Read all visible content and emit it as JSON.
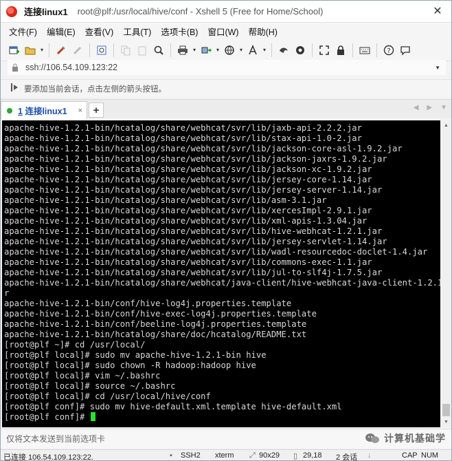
{
  "titlebar": {
    "app_name": "连接linux1",
    "title": "root@plf:/usr/local/hive/conf - Xshell 5 (Free for Home/School)",
    "close_label": "✕"
  },
  "menubar": {
    "items": [
      "文件(F)",
      "编辑(E)",
      "查看(V)",
      "工具(T)",
      "选项卡(B)",
      "窗口(W)",
      "帮助(H)"
    ]
  },
  "toolbar": {
    "icons": [
      "new-session-icon",
      "open-folder-icon",
      "reconnect-icon",
      "disconnect-icon",
      "properties-icon",
      "copy-icon",
      "paste-icon",
      "find-icon",
      "print-icon",
      "transfer-icon",
      "globe-icon",
      "font-icon",
      "xftp-icon",
      "xmanager-icon",
      "fullscreen-icon",
      "lock-icon",
      "keyboard-icon",
      "help-icon",
      "chat-icon"
    ]
  },
  "address": {
    "url": "ssh://106.54.109.123:22"
  },
  "hint": {
    "text": "要添加当前会话，点击左侧的箭头按钮。"
  },
  "tabs": {
    "active": {
      "number": "1",
      "label": "连接linux1",
      "close": "×"
    },
    "add": "+"
  },
  "terminal": {
    "lines": [
      "apache-hive-1.2.1-bin/hcatalog/share/webhcat/svr/lib/jaxb-api-2.2.2.jar",
      "apache-hive-1.2.1-bin/hcatalog/share/webhcat/svr/lib/stax-api-1.0-2.jar",
      "apache-hive-1.2.1-bin/hcatalog/share/webhcat/svr/lib/jackson-core-asl-1.9.2.jar",
      "apache-hive-1.2.1-bin/hcatalog/share/webhcat/svr/lib/jackson-jaxrs-1.9.2.jar",
      "apache-hive-1.2.1-bin/hcatalog/share/webhcat/svr/lib/jackson-xc-1.9.2.jar",
      "apache-hive-1.2.1-bin/hcatalog/share/webhcat/svr/lib/jersey-core-1.14.jar",
      "apache-hive-1.2.1-bin/hcatalog/share/webhcat/svr/lib/jersey-server-1.14.jar",
      "apache-hive-1.2.1-bin/hcatalog/share/webhcat/svr/lib/asm-3.1.jar",
      "apache-hive-1.2.1-bin/hcatalog/share/webhcat/svr/lib/xercesImpl-2.9.1.jar",
      "apache-hive-1.2.1-bin/hcatalog/share/webhcat/svr/lib/xml-apis-1.3.04.jar",
      "apache-hive-1.2.1-bin/hcatalog/share/webhcat/svr/lib/hive-webhcat-1.2.1.jar",
      "apache-hive-1.2.1-bin/hcatalog/share/webhcat/svr/lib/jersey-servlet-1.14.jar",
      "apache-hive-1.2.1-bin/hcatalog/share/webhcat/svr/lib/wadl-resourcedoc-doclet-1.4.jar",
      "apache-hive-1.2.1-bin/hcatalog/share/webhcat/svr/lib/commons-exec-1.1.jar",
      "apache-hive-1.2.1-bin/hcatalog/share/webhcat/svr/lib/jul-to-slf4j-1.7.5.jar",
      "apache-hive-1.2.1-bin/hcatalog/share/webhcat/java-client/hive-webhcat-java-client-1.2.1.ja",
      "r",
      "apache-hive-1.2.1-bin/conf/hive-log4j.properties.template",
      "apache-hive-1.2.1-bin/conf/hive-exec-log4j.properties.template",
      "apache-hive-1.2.1-bin/conf/beeline-log4j.properties.template",
      "apache-hive-1.2.1-bin/hcatalog/share/doc/hcatalog/README.txt",
      "[root@plf ~]# cd /usr/local/",
      "[root@plf local]# sudo mv apache-hive-1.2.1-bin hive",
      "[root@plf local]# sudo chown -R hadoop:hadoop hive",
      "[root@plf local]# vim ~/.bashrc",
      "[root@plf local]# source ~/.bashrc",
      "[root@plf local]# cd /usr/local/hive/conf",
      "[root@plf conf]# sudo mv hive-default.xml.template hive-default.xml"
    ],
    "prompt": "[root@plf conf]# ",
    "cursor_color": "#2de02d"
  },
  "sendbar": {
    "text": "仅将文本发送到当前选项卡"
  },
  "watermark": {
    "text": "计算机基础学"
  },
  "statusbar": {
    "connection": "已连接 106.54.109.123:22.",
    "protocol": "SSH2",
    "terminal_type": "xterm",
    "size": "90x29",
    "cursor_pos": "29,18",
    "sessions": "2 会话",
    "caps": "CAP",
    "num": "NUM"
  }
}
